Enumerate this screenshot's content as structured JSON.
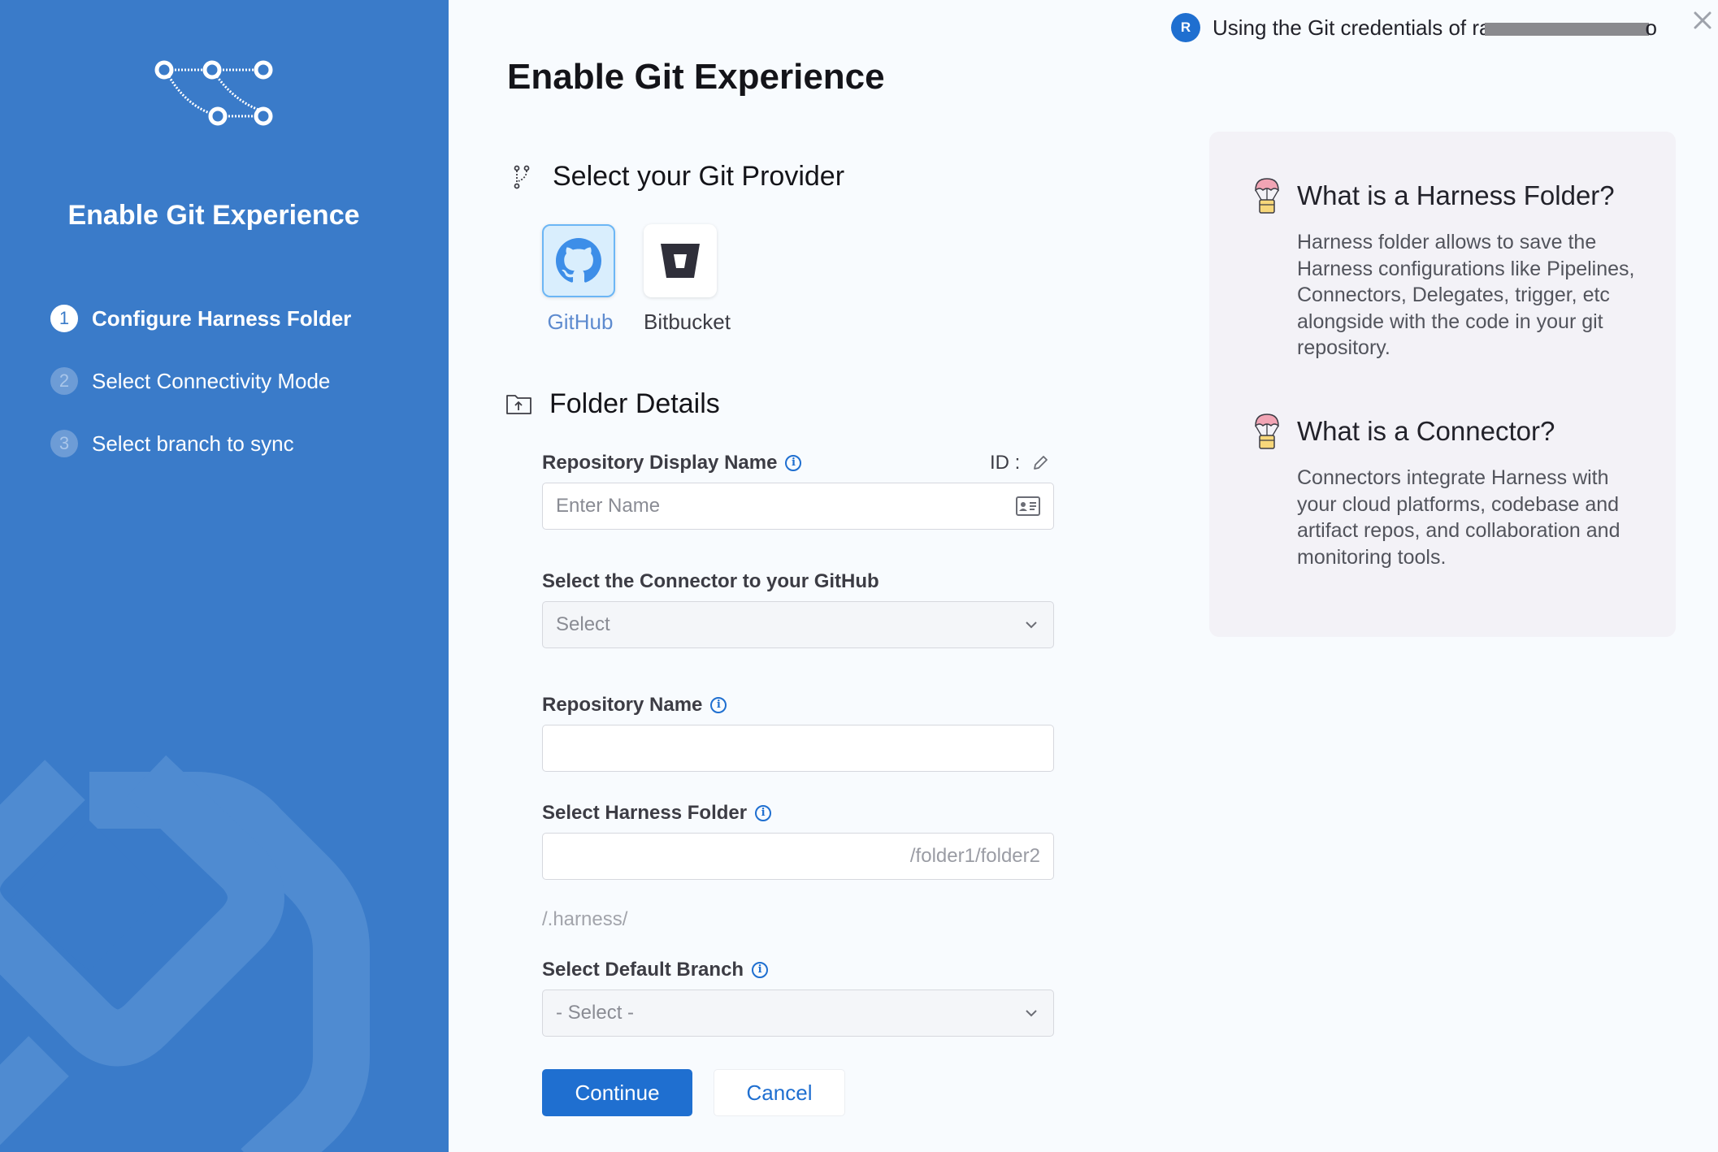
{
  "sidebar": {
    "title": "Enable Git Experience",
    "steps": [
      {
        "num": "1",
        "label": "Configure Harness Folder"
      },
      {
        "num": "2",
        "label": "Select Connectivity Mode"
      },
      {
        "num": "3",
        "label": "Select branch to sync"
      }
    ]
  },
  "header": {
    "avatar_letter": "R",
    "credentials_prefix": "Using the Git credentials of ra",
    "credentials_suffix": "o"
  },
  "main": {
    "title": "Enable Git Experience",
    "provider_section": "Select your Git Provider",
    "providers": [
      {
        "name": "GitHub",
        "selected": true
      },
      {
        "name": "Bitbucket",
        "selected": false
      }
    ],
    "folder_section": "Folder Details",
    "fields": {
      "repo_display_name_label": "Repository Display Name",
      "id_label": "ID :",
      "repo_display_name_placeholder": "Enter Name",
      "connector_label": "Select the Connector to your GitHub",
      "connector_value": "Select",
      "repo_name_label": "Repository Name",
      "repo_name_value": "",
      "harness_folder_label": "Select Harness Folder",
      "harness_folder_suffix": "/folder1/folder2",
      "harness_path": "/.harness/",
      "default_branch_label": "Select Default Branch",
      "default_branch_value": "- Select -"
    },
    "buttons": {
      "continue": "Continue",
      "cancel": "Cancel"
    }
  },
  "help": {
    "items": [
      {
        "title": "What is a Harness Folder?",
        "body": "Harness folder allows to save the Harness configurations like Pipelines, Connectors, Delegates, trigger, etc alongside with the code in your git repository."
      },
      {
        "title": "What is a Connector?",
        "body": "Connectors integrate Harness with your cloud platforms, codebase and artifact repos, and collaboration and monitoring tools."
      }
    ]
  },
  "colors": {
    "sidebar_bg": "#3a7bc9",
    "primary": "#1f6fd0",
    "selected_tile": "#d9eefd",
    "help_bg": "#f3f2f7"
  }
}
